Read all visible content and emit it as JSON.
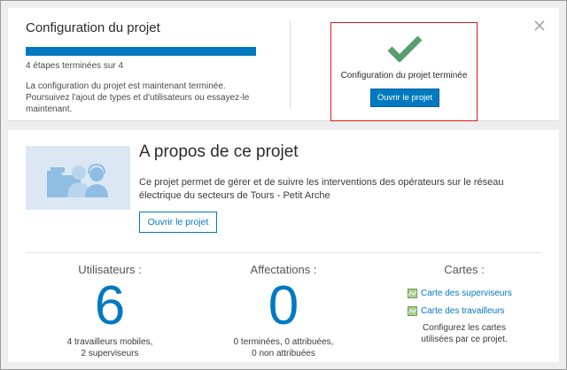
{
  "setup": {
    "title": "Configuration du projet",
    "progress_fraction": 1.0,
    "steps_text": "4 étapes terminées sur 4",
    "description": "La configuration du projet est maintenant terminée. Poursuivez l'ajout de types et d'utilisateurs ou essayez-le maintenant.",
    "done_text": "Configuration du projet terminée",
    "open_button": "Ouvrir le projet",
    "close_icon": "close-icon",
    "check_icon": "checkmark-icon"
  },
  "about": {
    "title": "A propos de ce projet",
    "description": "Ce projet permet de gérer et de suivre les interventions des opérateurs sur le réseau électrique du secteurs de Tours - Petit Arche",
    "open_button": "Ouvrir le projet",
    "illustration_icon": "users-folder-icon"
  },
  "stats": {
    "users": {
      "label": "Utilisateurs :",
      "value": "6",
      "sub1": "4 travailleurs mobiles,",
      "sub2": "2 superviseurs"
    },
    "assignments": {
      "label": "Affectations :",
      "value": "0",
      "sub1": "0 terminées, 0 attribuées,",
      "sub2": "0 non attribuées"
    },
    "maps": {
      "label": "Cartes :",
      "links": [
        "Carte des superviseurs",
        "Carte des travailleurs"
      ],
      "sub1": "Configurez les cartes",
      "sub2": "utilisées par ce projet."
    }
  },
  "colors": {
    "accent": "#0079c1",
    "check": "#5a9e6e",
    "highlight_border": "#e0161c"
  }
}
